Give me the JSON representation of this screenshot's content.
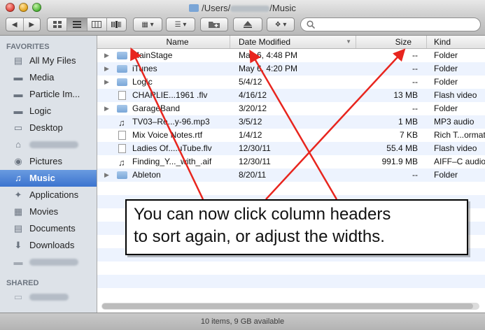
{
  "window": {
    "path_prefix": "/Users/",
    "path_suffix": "/Music"
  },
  "toolbar": {
    "search_placeholder": ""
  },
  "sidebar": {
    "favorites_heading": "FAVORITES",
    "shared_heading": "SHARED",
    "items": [
      {
        "label": "All My Files",
        "icon": "all-files-icon"
      },
      {
        "label": "Media",
        "icon": "folder-icon"
      },
      {
        "label": "Particle Im...",
        "icon": "folder-icon"
      },
      {
        "label": "Logic",
        "icon": "folder-icon"
      },
      {
        "label": "Desktop",
        "icon": "desktop-icon"
      },
      {
        "label": "",
        "icon": "home-icon"
      },
      {
        "label": "Pictures",
        "icon": "pictures-icon"
      },
      {
        "label": "Music",
        "icon": "music-icon"
      },
      {
        "label": "Applications",
        "icon": "applications-icon"
      },
      {
        "label": "Movies",
        "icon": "movies-icon"
      },
      {
        "label": "Documents",
        "icon": "documents-icon"
      },
      {
        "label": "Downloads",
        "icon": "downloads-icon"
      }
    ]
  },
  "columns": {
    "name": "Name",
    "date": "Date Modified",
    "size": "Size",
    "kind": "Kind"
  },
  "files": [
    {
      "name": "MainStage",
      "date": "May 6, 4:48 PM",
      "size": "--",
      "kind": "Folder",
      "type": "folder"
    },
    {
      "name": "iTunes",
      "date": "May 6, 4:20 PM",
      "size": "--",
      "kind": "Folder",
      "type": "folder"
    },
    {
      "name": "Logic",
      "date": "5/4/12",
      "size": "--",
      "kind": "Folder",
      "type": "folder"
    },
    {
      "name": "CHARLIE...1961 .flv",
      "date": "4/16/12",
      "size": "13 MB",
      "kind": "Flash video",
      "type": "doc"
    },
    {
      "name": "GarageBand",
      "date": "3/20/12",
      "size": "--",
      "kind": "Folder",
      "type": "folder"
    },
    {
      "name": "TV03–Re...y-96.mp3",
      "date": "3/5/12",
      "size": "1 MB",
      "kind": "MP3 audio",
      "type": "music"
    },
    {
      "name": "Mix Voice Notes.rtf",
      "date": "1/4/12",
      "size": "7 KB",
      "kind": "Rich T...ormat",
      "type": "doc"
    },
    {
      "name": "Ladies Of....uTube.flv",
      "date": "12/30/11",
      "size": "55.4 MB",
      "kind": "Flash video",
      "type": "doc"
    },
    {
      "name": "Finding_Y..._with_.aif",
      "date": "12/30/11",
      "size": "991.9 MB",
      "kind": "AIFF–C audio",
      "type": "music"
    },
    {
      "name": "Ableton",
      "date": "8/20/11",
      "size": "--",
      "kind": "Folder",
      "type": "folder"
    }
  ],
  "status": "10 items, 9 GB available",
  "callout": {
    "line1": "You can now click column headers",
    "line2": "to sort again, or adjust the widths."
  }
}
